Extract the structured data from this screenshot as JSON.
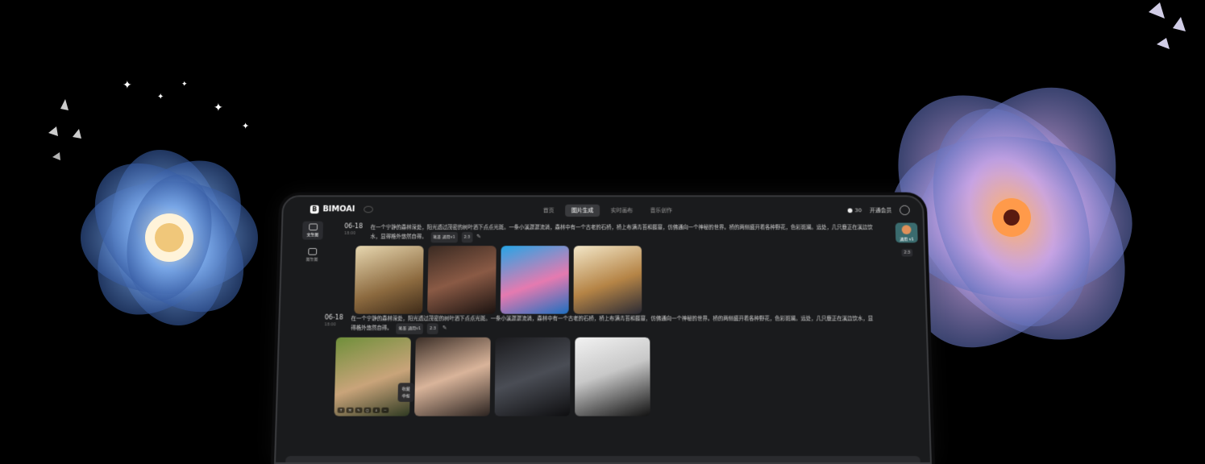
{
  "app": {
    "brand": "BIMOAI",
    "tabs": [
      {
        "label": "首页",
        "active": false
      },
      {
        "label": "图片生成",
        "active": true
      },
      {
        "label": "实时画布",
        "active": false
      },
      {
        "label": "音乐创作",
        "active": false
      }
    ],
    "coins": "30",
    "vip_label": "开通会员"
  },
  "leftnav": [
    {
      "label": "文生图",
      "active": true,
      "icon": "image-icon"
    },
    {
      "label": "图生图",
      "active": false,
      "icon": "images-icon"
    }
  ],
  "rightpanel": {
    "style_label": "通用 v1",
    "ratio": "2:3"
  },
  "records": [
    {
      "date": "06-18",
      "time": "18:00",
      "prompt": "在一个宁静的森林深处，阳光透过茂密的树叶洒下点点光斑。一条小溪潺潺流淌，森林中有一个古老的石桥，桥上布满青苔和藤蔓，仿佛通向一个神秘的世界。桥的两侧盛开着各种野花，色彩斑斓。远处，几只鹿正在溪边饮水，显得格外悠然自得。",
      "chips": [
        "笔墨 通用v1",
        "2:3"
      ]
    },
    {
      "date": "06-18",
      "time": "18:00",
      "prompt": "在一个宁静的森林深处，阳光透过茂密的树叶洒下点点光斑。一条小溪潺潺流淌，森林中有一个古老的石桥，桥上布满青苔和藤蔓，仿佛通向一个神秘的世界。桥的两侧盛开着各种野花，色彩斑斓。远处，几只鹿正在溪边饮水，显得格外悠然自得。",
      "chips": [
        "笔墨 通用v1",
        "2:3"
      ]
    }
  ],
  "hover_menu": [
    "收藏",
    "举报"
  ],
  "colors": {
    "background": "#000000",
    "tablet": "#1a1b1d",
    "active_tab": "#3a3b3e"
  }
}
